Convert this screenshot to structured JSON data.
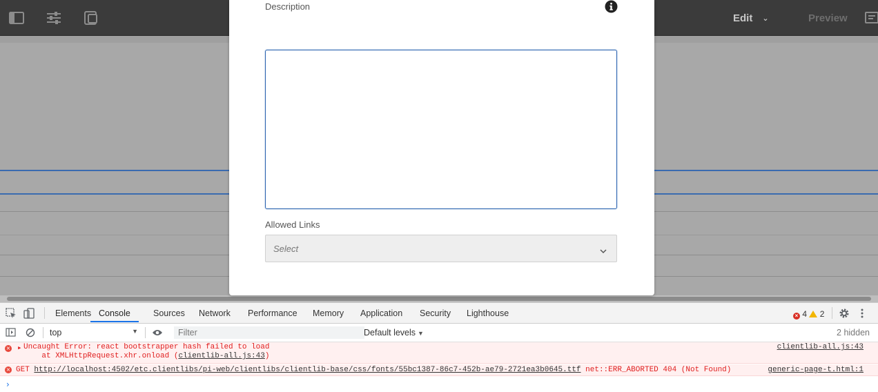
{
  "toolbar": {
    "edit_label": "Edit",
    "preview_label": "Preview",
    "icons": [
      "side-panel-icon",
      "properties-icon",
      "emulator-icon",
      "annotations-icon"
    ]
  },
  "dialog": {
    "description_label": "Description",
    "description_value": "",
    "allowed_links_label": "Allowed Links",
    "allowed_links_placeholder": "Select"
  },
  "devtools": {
    "tabs": [
      {
        "label": "Elements",
        "active": false
      },
      {
        "label": "Console",
        "active": true
      },
      {
        "label": "Sources",
        "active": false
      },
      {
        "label": "Network",
        "active": false
      },
      {
        "label": "Performance",
        "active": false
      },
      {
        "label": "Memory",
        "active": false
      },
      {
        "label": "Application",
        "active": false
      },
      {
        "label": "Security",
        "active": false
      },
      {
        "label": "Lighthouse",
        "active": false
      }
    ],
    "error_count": "4",
    "warning_count": "2",
    "context": "top",
    "filter_placeholder": "Filter",
    "levels_label": "Default levels",
    "hidden_label": "2 hidden",
    "messages": [
      {
        "line1": "Uncaught Error: react bootstrapper hash failed to load",
        "line2_prefix": "    at XMLHttpRequest.xhr.onload (",
        "line2_link": "clientlib-all.js:43",
        "line2_suffix": ")",
        "source": "clientlib-all.js:43"
      },
      {
        "prefix": "GET ",
        "url": "http://localhost:4502/etc.clientlibs/pi-web/clientlibs/clientlib-base/css/fonts/55bc1387-86c7-452b-ae79-2721ea3b0645.ttf",
        "suffix": " net::ERR_ABORTED 404 (Not Found)",
        "source": "generic-page-t.html:1"
      }
    ]
  },
  "colors": {
    "toolbar_bg": "#3b3b3b",
    "accent_blue": "#2b63b0",
    "console_error": "#e01e1e",
    "devtools_active_tab": "#1a73e8"
  }
}
